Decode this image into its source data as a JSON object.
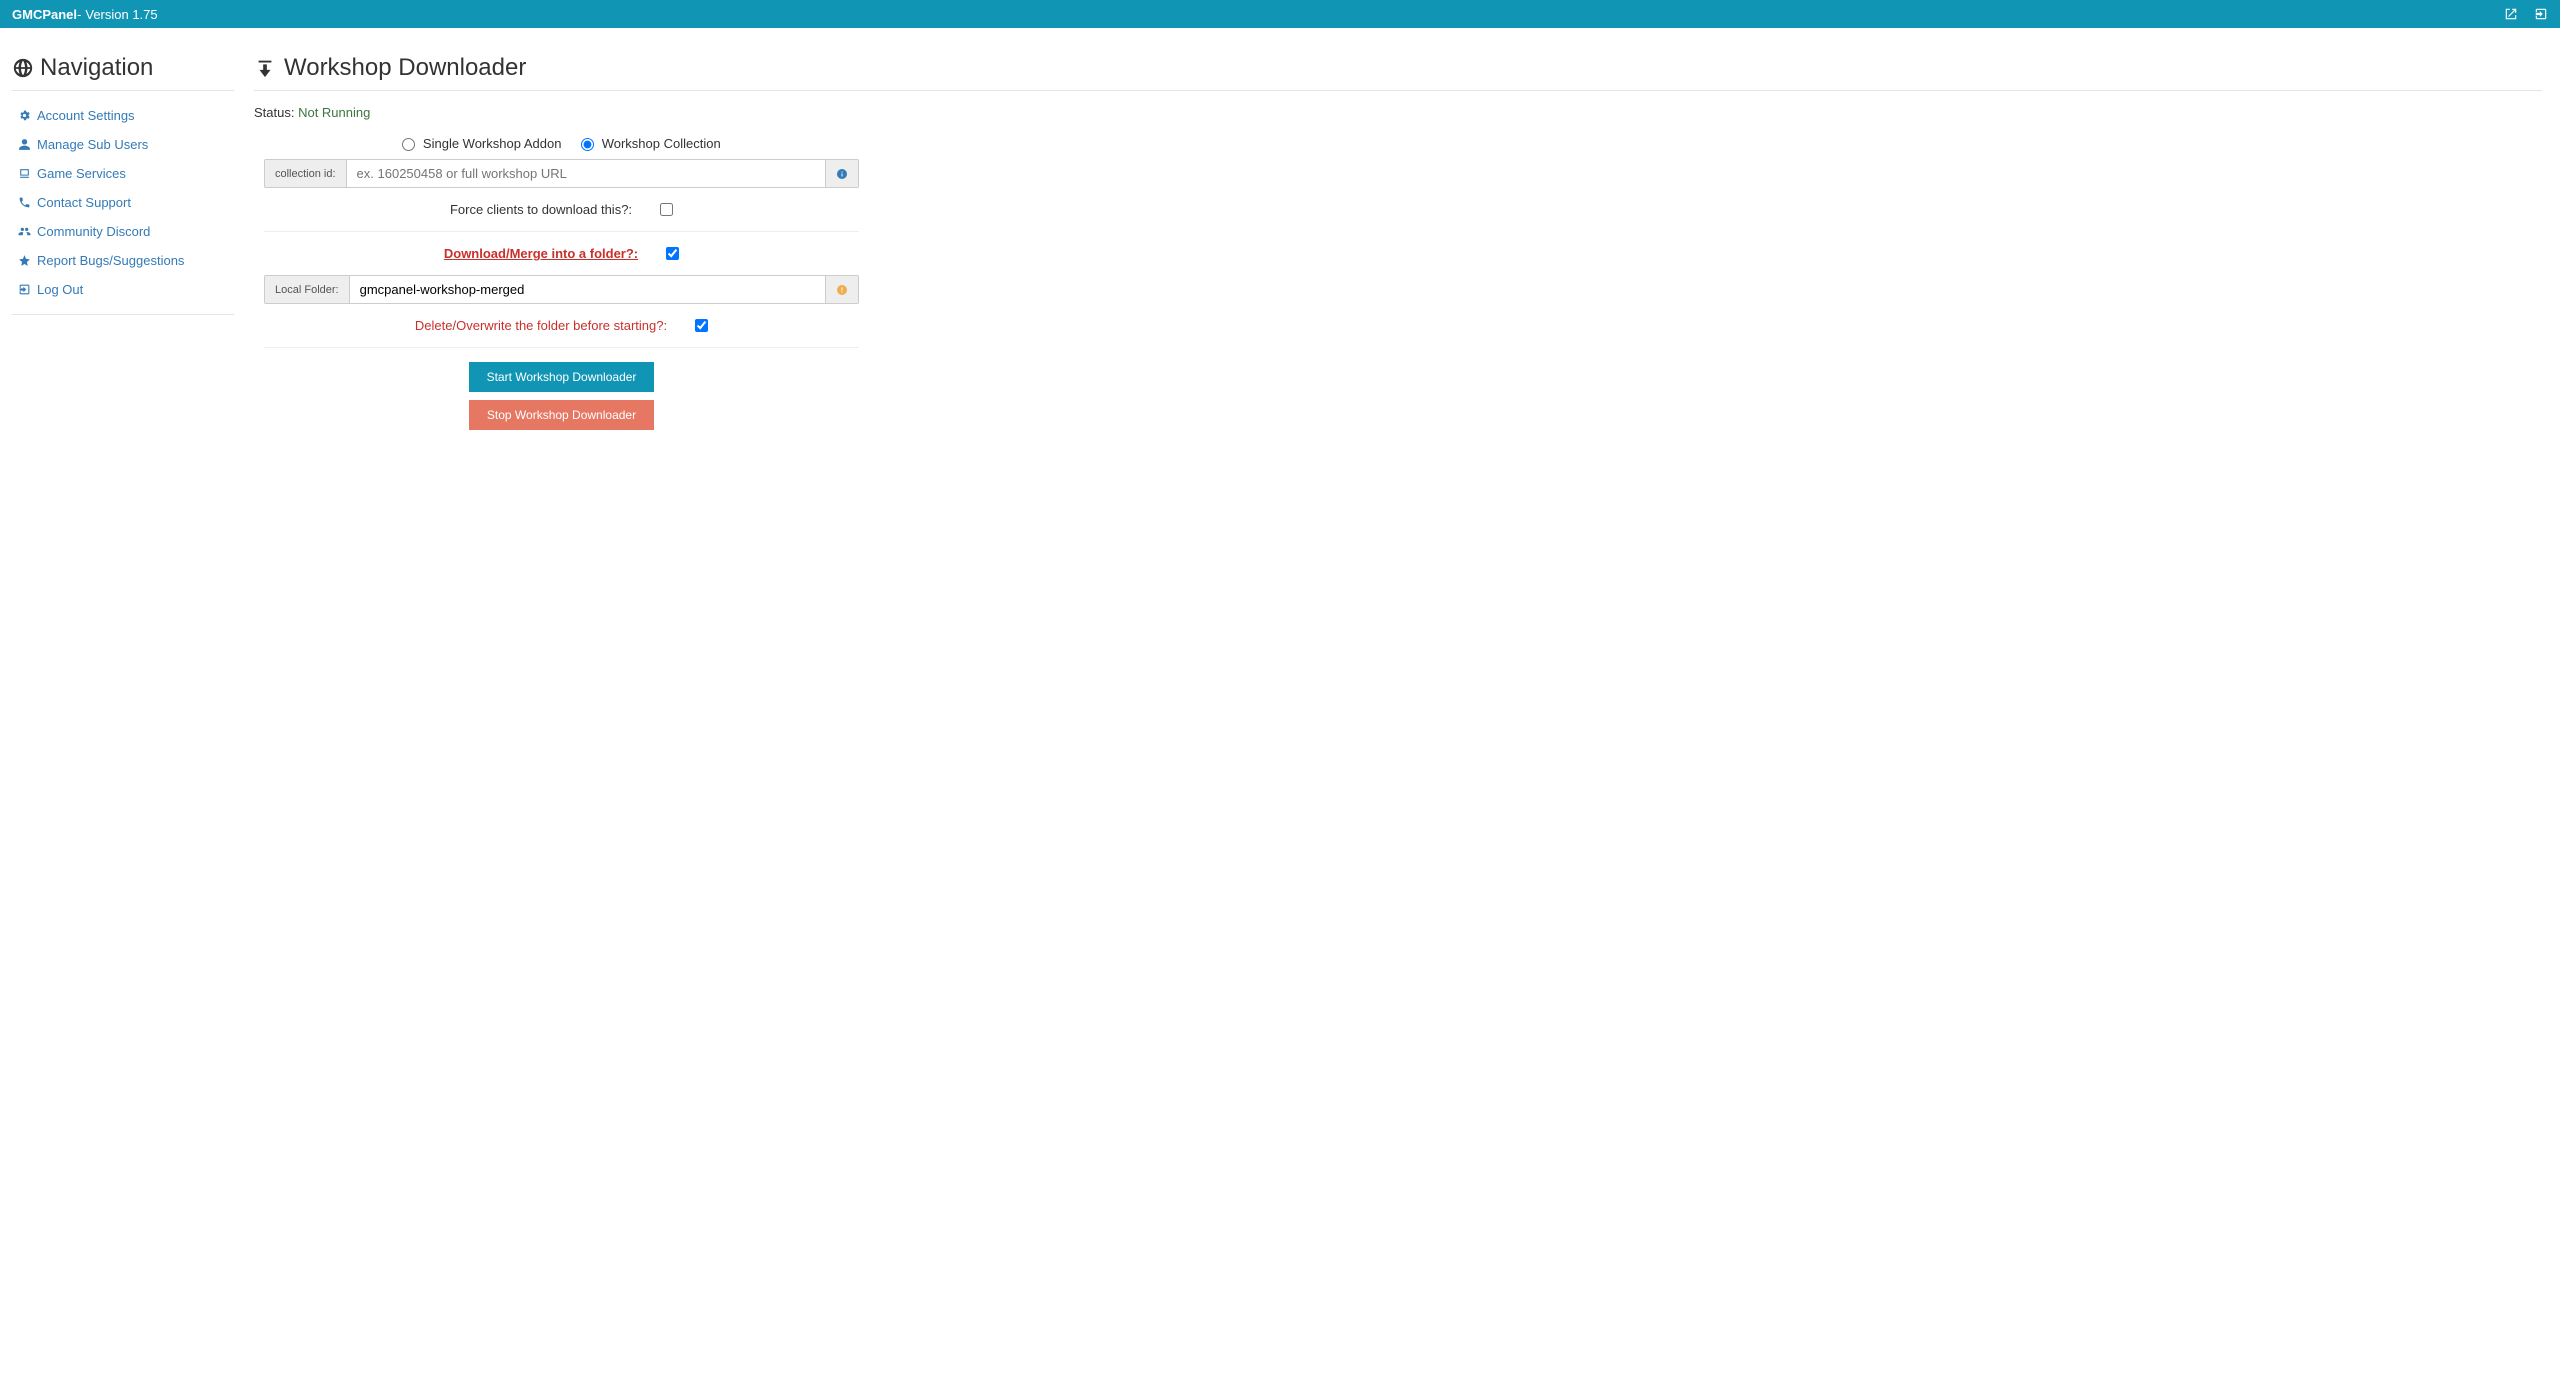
{
  "topbar": {
    "brand": "GMCPanel",
    "separator": " - ",
    "version": "Version 1.75"
  },
  "sidebar": {
    "title": "Navigation",
    "items": [
      {
        "label": "Account Settings"
      },
      {
        "label": "Manage Sub Users"
      },
      {
        "label": "Game Services"
      },
      {
        "label": "Contact Support"
      },
      {
        "label": "Community Discord"
      },
      {
        "label": "Report Bugs/Suggestions"
      },
      {
        "label": "Log Out"
      }
    ]
  },
  "page": {
    "title": "Workshop Downloader",
    "status_label": "Status: ",
    "status_value": "Not Running"
  },
  "form": {
    "radio_single": "Single Workshop Addon",
    "radio_collection": "Workshop Collection",
    "collection_label": "collection id:",
    "collection_placeholder": "ex. 160250458 or full workshop URL",
    "force_label": "Force clients to download this?:",
    "merge_label": "Download/Merge into a folder?:",
    "folder_label": "Local Folder:",
    "folder_value": "gmcpanel-workshop-merged",
    "delete_label": "Delete/Overwrite the folder before starting?:",
    "start_button": "Start Workshop Downloader",
    "stop_button": "Stop Workshop Downloader"
  }
}
